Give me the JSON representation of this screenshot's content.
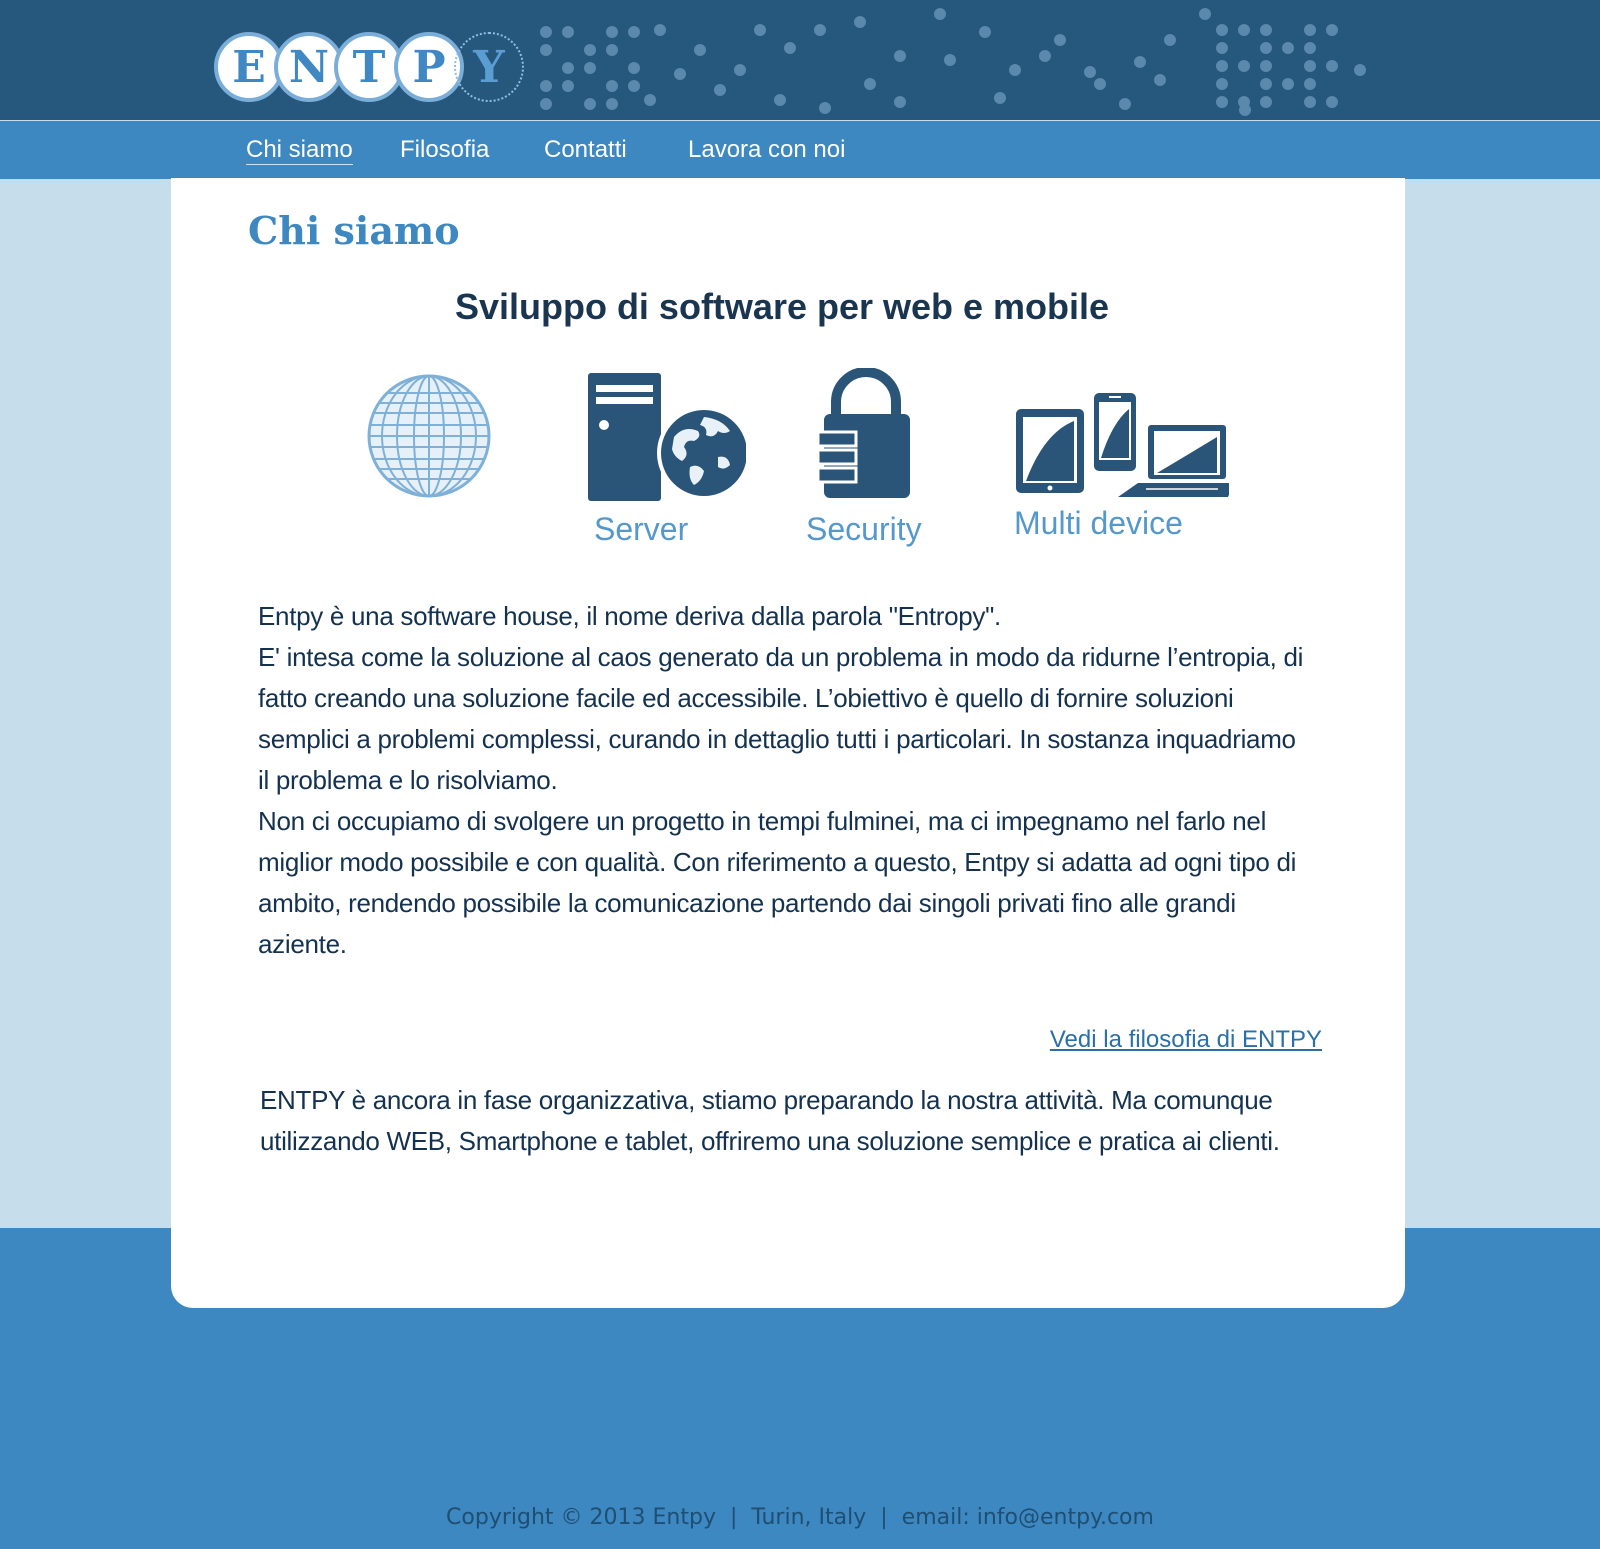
{
  "logo": {
    "letters": [
      "E",
      "N",
      "T",
      "P",
      "Y"
    ]
  },
  "nav": {
    "items": [
      {
        "label": "Chi siamo"
      },
      {
        "label": "Filosofia"
      },
      {
        "label": "Contatti"
      },
      {
        "label": "Lavora con noi"
      }
    ]
  },
  "main": {
    "title": "Chi siamo",
    "subtitle": "Sviluppo di software per web e mobile",
    "features": [
      {
        "label": "",
        "icon": "globe-icon"
      },
      {
        "label": "Server",
        "icon": "server-icon"
      },
      {
        "label": "Security",
        "icon": "padlock-icon"
      },
      {
        "label": "Multi device",
        "icon": "devices-icon"
      }
    ],
    "paragraphs": [
      "Entpy è una software house, il nome deriva dalla parola \"Entropy\".",
      "E' intesa come la soluzione al caos generato da un problema in modo da ridurne l’entropia, di fatto creando una soluzione facile ed accessibile. L’obiettivo è quello di fornire soluzioni semplici a problemi complessi, curando in dettaglio tutti i particolari. In sostanza inquadriamo il problema e lo risolviamo.",
      "Non ci occupiamo di svolgere un progetto in tempi fulminei, ma ci impegnamo nel farlo nel miglior modo possibile e con qualità. Con riferimento a questo, Entpy si adatta ad ogni tipo di ambito, rendendo possibile la comunicazione partendo dai singoli privati fino alle grandi aziente."
    ],
    "philosophy_link": "Vedi la filosofia di ENTPY",
    "status": "ENTPY è ancora in fase organizzativa, stiamo preparando la nostra attività. Ma comunque utilizzando WEB, Smartphone e tablet, offriremo una soluzione semplice e pratica ai clienti."
  },
  "footer": {
    "copyright": "Copyright © 2013 Entpy",
    "location": "Turin, Italy",
    "email": "email: info@entpy.com",
    "separator": "|"
  },
  "colors": {
    "header_bg": "#26577c",
    "nav_bg": "#3d88c1",
    "page_bg": "#c6ddec",
    "accent": "#3d88c1",
    "icon_dark": "#2a5478",
    "text_dark": "#14324f"
  }
}
